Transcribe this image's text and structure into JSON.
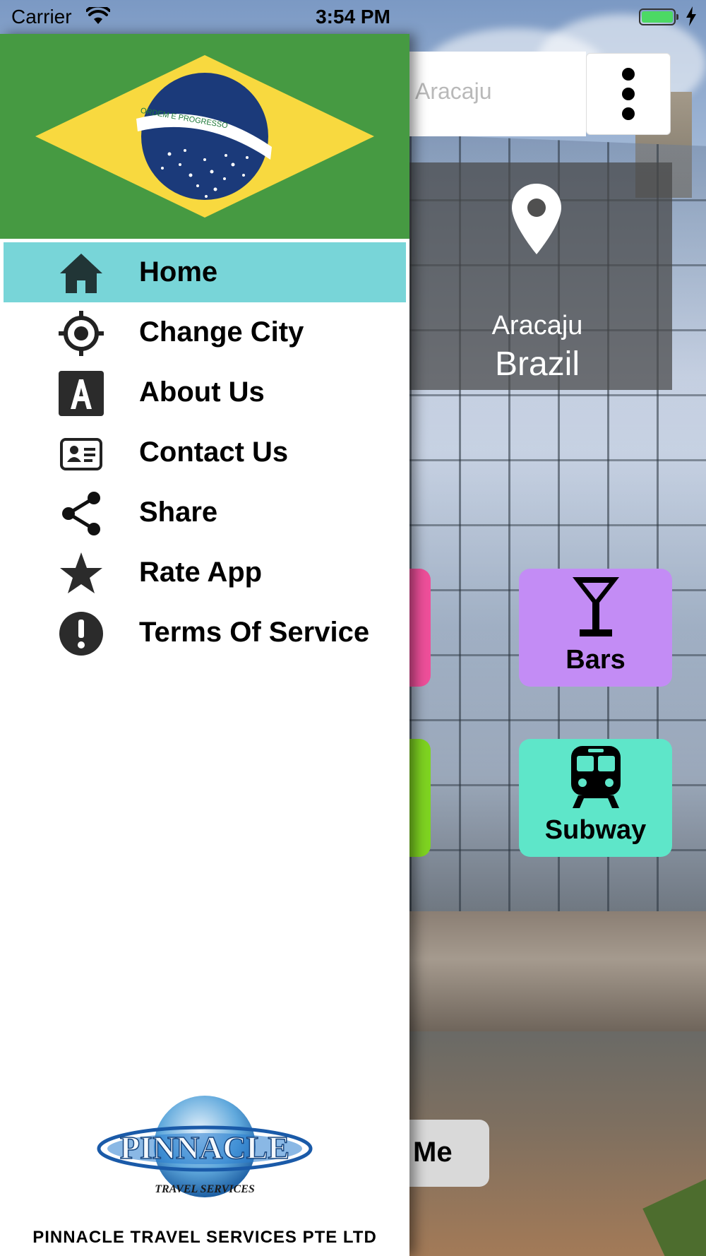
{
  "status_bar": {
    "carrier": "Carrier",
    "time": "3:54 PM"
  },
  "search": {
    "placeholder": "Aracaju"
  },
  "location_card": {
    "city": "Aracaju",
    "country": "Brazil"
  },
  "categories": [
    {
      "label": "Bars",
      "icon": "cocktail-glass-icon",
      "color": "#c38cf5"
    },
    {
      "label": "Subway",
      "icon": "train-icon",
      "color": "#5ee6c9"
    }
  ],
  "hidden_tiles": {
    "pink_color": "#ee4f9a",
    "green_color": "#7ed321"
  },
  "find_me_button": {
    "label": "Me"
  },
  "drawer": {
    "header_image": "brazil-flag",
    "flag_motto": "ORDEM E PROGRESSO",
    "menu": [
      {
        "label": "Home",
        "icon": "home-icon",
        "active": true
      },
      {
        "label": "Change City",
        "icon": "crosshair-icon",
        "active": false
      },
      {
        "label": "About Us",
        "icon": "letter-a-icon",
        "active": false
      },
      {
        "label": "Contact Us",
        "icon": "contact-card-icon",
        "active": false
      },
      {
        "label": "Share",
        "icon": "share-icon",
        "active": false
      },
      {
        "label": "Rate App",
        "icon": "star-icon",
        "active": false
      },
      {
        "label": "Terms Of Service",
        "icon": "exclamation-icon",
        "active": false
      }
    ],
    "logo": {
      "brand": "PINNACLE",
      "tagline": "TRAVEL SERVICES"
    },
    "company_name": "PINNACLE TRAVEL SERVICES PTE LTD"
  },
  "colors": {
    "active_item": "#78d5d8",
    "flag_green": "#469a42",
    "flag_yellow": "#f8d93f",
    "flag_blue": "#1b3a7a"
  }
}
